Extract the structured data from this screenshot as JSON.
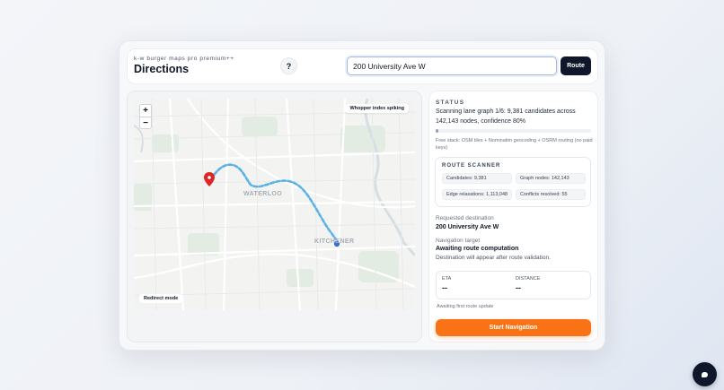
{
  "header": {
    "eyebrow": "k-w burger maps pro premium++",
    "title": "Directions",
    "help_label": "?",
    "search": {
      "value": "200 University Ave W",
      "placeholder": ""
    },
    "route_label": "Route"
  },
  "map": {
    "zoom_in": "+",
    "zoom_out": "−",
    "badge": "Whopper index spiking",
    "mode": "Redirect mode",
    "labels": {
      "waterloo": "WATERLOO",
      "kitchener": "KITCHENER"
    },
    "route_color": "#5ab2e6",
    "marker_color": "#dc2626",
    "origin_color": "#3b6fd4"
  },
  "status": {
    "heading": "STATUS",
    "text": "Scanning lane graph 1/6: 9,381 candidates across 142,143 nodes, confidence 80%",
    "progress": 0.02,
    "free_stack": "Free stack: OSM tiles + Nominatim geocoding + OSRM routing (no paid keys)"
  },
  "scanner": {
    "heading": "ROUTE SCANNER",
    "candidates": "Candidates: 9,381",
    "graph_nodes": "Graph nodes: 142,143",
    "edge_relaxations": "Edge relaxations: 1,113,048",
    "conflicts": "Conflicts resolved: 55"
  },
  "destination": {
    "requested_label": "Requested destination",
    "requested_value": "200 University Ave W",
    "target_label": "Navigation target",
    "target_value": "Awaiting route computation",
    "note": "Destination will appear after route validation."
  },
  "metrics": {
    "eta_label": "ETA",
    "eta_value": "--",
    "distance_label": "DISTANCE",
    "distance_value": "--",
    "awaiting": "Awaiting first route update"
  },
  "start_label": "Start Navigation",
  "colors": {
    "accent": "#f97316",
    "dark": "#0f172a"
  }
}
